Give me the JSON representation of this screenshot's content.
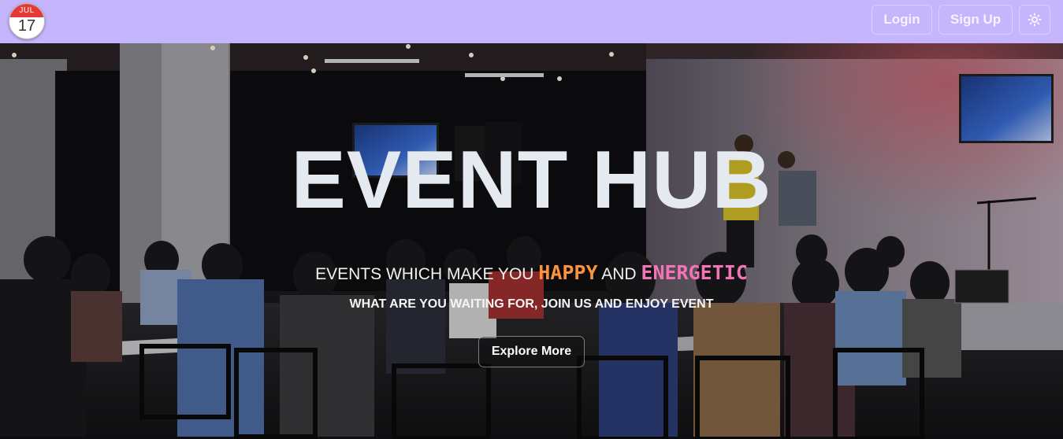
{
  "logo": {
    "month": "JUL",
    "day": "17"
  },
  "nav": {
    "login_label": "Login",
    "signup_label": "Sign Up",
    "theme_toggle_icon": "sun-icon"
  },
  "hero": {
    "title": "EVENT HUB",
    "tagline_prefix": "EVENTS WHICH MAKE YOU ",
    "tagline_word1": "HAPPY",
    "tagline_mid": " AND ",
    "tagline_word2": "ENERGETIC",
    "subtitle": "WHAT ARE YOU WAITING FOR, JOIN US AND ENJOY EVENT",
    "cta_label": "Explore More",
    "background_image": "event-audience-photo"
  },
  "colors": {
    "navbar_bg": "#c4b5fd",
    "happy": "#fb923c",
    "energetic": "#f472b6",
    "title": "#e5e9f0"
  }
}
